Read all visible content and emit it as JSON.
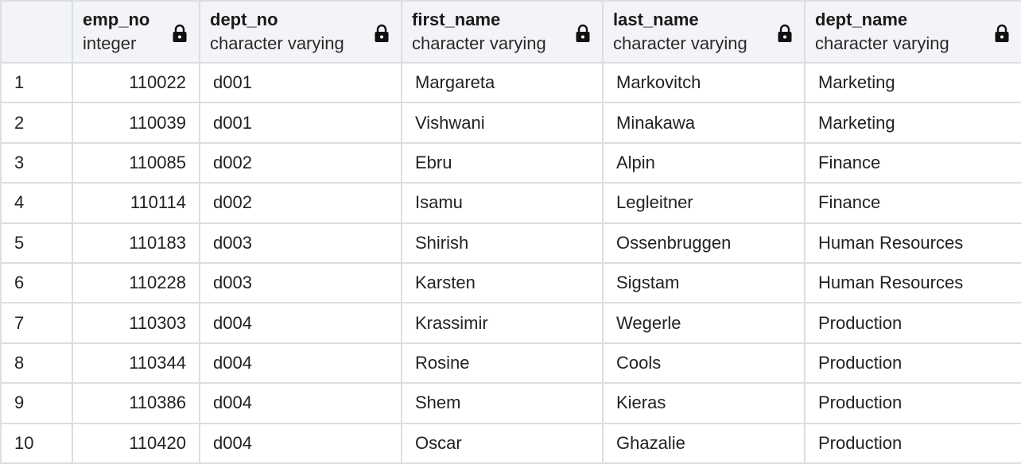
{
  "columns": [
    {
      "name": "emp_no",
      "type": "integer"
    },
    {
      "name": "dept_no",
      "type": "character varying"
    },
    {
      "name": "first_name",
      "type": "character varying"
    },
    {
      "name": "last_name",
      "type": "character varying"
    },
    {
      "name": "dept_name",
      "type": "character varying"
    }
  ],
  "rows": [
    {
      "n": "1",
      "emp_no": "110022",
      "dept_no": "d001",
      "first_name": "Margareta",
      "last_name": "Markovitch",
      "dept_name": "Marketing"
    },
    {
      "n": "2",
      "emp_no": "110039",
      "dept_no": "d001",
      "first_name": "Vishwani",
      "last_name": "Minakawa",
      "dept_name": "Marketing"
    },
    {
      "n": "3",
      "emp_no": "110085",
      "dept_no": "d002",
      "first_name": "Ebru",
      "last_name": "Alpin",
      "dept_name": "Finance"
    },
    {
      "n": "4",
      "emp_no": "110114",
      "dept_no": "d002",
      "first_name": "Isamu",
      "last_name": "Legleitner",
      "dept_name": "Finance"
    },
    {
      "n": "5",
      "emp_no": "110183",
      "dept_no": "d003",
      "first_name": "Shirish",
      "last_name": "Ossenbruggen",
      "dept_name": "Human Resources"
    },
    {
      "n": "6",
      "emp_no": "110228",
      "dept_no": "d003",
      "first_name": "Karsten",
      "last_name": "Sigstam",
      "dept_name": "Human Resources"
    },
    {
      "n": "7",
      "emp_no": "110303",
      "dept_no": "d004",
      "first_name": "Krassimir",
      "last_name": "Wegerle",
      "dept_name": "Production"
    },
    {
      "n": "8",
      "emp_no": "110344",
      "dept_no": "d004",
      "first_name": "Rosine",
      "last_name": "Cools",
      "dept_name": "Production"
    },
    {
      "n": "9",
      "emp_no": "110386",
      "dept_no": "d004",
      "first_name": "Shem",
      "last_name": "Kieras",
      "dept_name": "Production"
    },
    {
      "n": "10",
      "emp_no": "110420",
      "dept_no": "d004",
      "first_name": "Oscar",
      "last_name": "Ghazalie",
      "dept_name": "Production"
    }
  ],
  "icons": {
    "lock": "lock-icon"
  },
  "colors": {
    "header_bg": "#f3f4f7",
    "border": "#dcdee3"
  }
}
